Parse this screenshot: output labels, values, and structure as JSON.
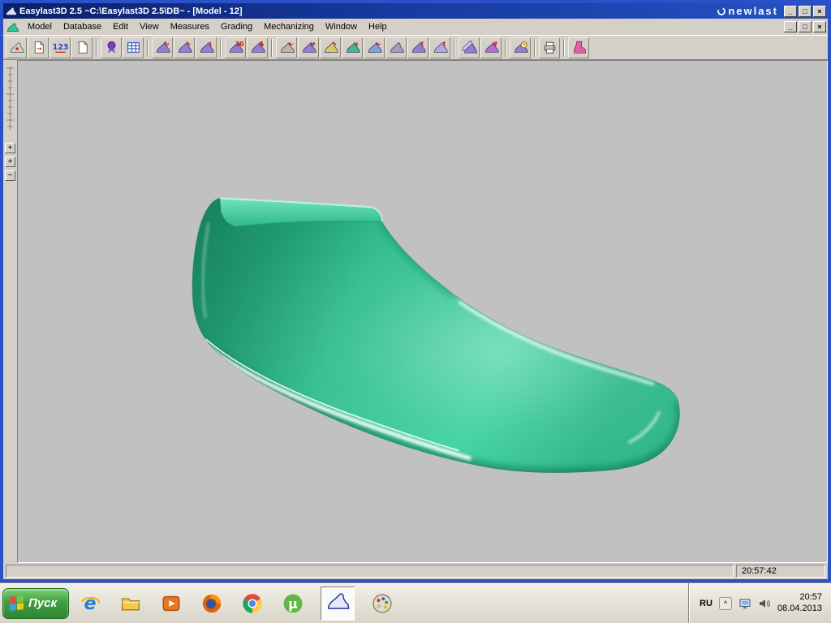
{
  "window": {
    "title": "Easylast3D 2.5 ~C:\\Easylast3D 2.5\\DB~ - [Model - 12]",
    "brand": "newlast",
    "controls": {
      "minimize": "_",
      "maximize": "□",
      "restore": "□",
      "close": "×"
    }
  },
  "menu": {
    "items": [
      "Model",
      "Database",
      "Edit",
      "View",
      "Measures",
      "Grading",
      "Mechanizing",
      "Window",
      "Help"
    ]
  },
  "toolbar": {
    "buttons": [
      {
        "name": "last-top-view",
        "kind": "outline",
        "color": "#6a7a88"
      },
      {
        "name": "import-model",
        "kind": "page",
        "glyph": "→"
      },
      {
        "name": "measurement-digits",
        "kind": "digits",
        "color": "#2a48c0"
      },
      {
        "name": "export-page",
        "kind": "page"
      },
      {
        "name": "wizard",
        "kind": "ribbon",
        "color": "#7b3fc4",
        "sep_before": true
      },
      {
        "name": "size-table",
        "kind": "grid",
        "color": "#2a50c0"
      },
      {
        "name": "last-rotate",
        "kind": "shoe",
        "color": "#8f7fd8",
        "glyph": "↻",
        "sep_before": true
      },
      {
        "name": "last-edit",
        "kind": "shoe",
        "color": "#8f7fd8",
        "glyph": "✎"
      },
      {
        "name": "last-lower",
        "kind": "shoe",
        "color": "#8f7fd8",
        "glyph": "↓"
      },
      {
        "name": "angle-30",
        "kind": "shoe",
        "color": "#8f7fd8",
        "glyph": "30",
        "sep_before": true
      },
      {
        "name": "compass-measure",
        "kind": "shoe",
        "color": "#8f7fd8",
        "glyph": "A"
      },
      {
        "name": "foot-measure",
        "kind": "shoe",
        "color": "#c8b2a0",
        "glyph": "←",
        "sep_before": true
      },
      {
        "name": "last-stretch",
        "kind": "shoe",
        "color": "#8f7fd8",
        "glyph": "⇄"
      },
      {
        "name": "last-mark",
        "kind": "shoe",
        "color": "#d8c860",
        "glyph": "✎"
      },
      {
        "name": "last-remove",
        "kind": "shoe",
        "color": "#40b890",
        "glyph": "×"
      },
      {
        "name": "last-shift",
        "kind": "shoe",
        "color": "#80a0e0",
        "glyph": "←"
      },
      {
        "name": "last-copy",
        "kind": "shoe",
        "color": "#a0a0b0"
      },
      {
        "name": "last-height",
        "kind": "shoe",
        "color": "#8f7fd8",
        "glyph": "↕"
      },
      {
        "name": "last-adjust",
        "kind": "shoe",
        "color": "#b0a8e0",
        "glyph": "↕"
      },
      {
        "name": "compare-lasts",
        "kind": "shoe2",
        "color": "#8f7fd8",
        "sep_before": true
      },
      {
        "name": "last-net",
        "kind": "shoe",
        "color": "#b06fd8",
        "glyph": "#"
      },
      {
        "name": "last-zoom-time",
        "kind": "magnify",
        "color": "#8f7fd8",
        "sep_before": true
      },
      {
        "name": "print",
        "kind": "printer",
        "color": "#808080",
        "sep_before": true
      },
      {
        "name": "last-info",
        "kind": "boot",
        "color": "#e060a8",
        "sep_before": true
      }
    ]
  },
  "side_panel": {
    "buttons": [
      {
        "name": "zoom-in-1",
        "glyph": "+"
      },
      {
        "name": "zoom-in-2",
        "glyph": "+"
      },
      {
        "name": "zoom-out",
        "glyph": "−"
      }
    ]
  },
  "model": {
    "body_color": "#2cbd8d",
    "top_color": "#49d6a8",
    "shadow_color": "#0c6b4c",
    "highlight_color": "#ffffff",
    "canvas_background": "#c1c1c1"
  },
  "statusbar": {
    "time": "20:57:42"
  },
  "taskbar": {
    "start_label": "Пуск",
    "quick_launch": [
      {
        "name": "internet-explorer",
        "kind": "ie"
      },
      {
        "name": "file-explorer",
        "kind": "folder"
      },
      {
        "name": "media-player",
        "kind": "media"
      },
      {
        "name": "firefox",
        "kind": "firefox"
      },
      {
        "name": "chrome",
        "kind": "chrome"
      },
      {
        "name": "utorrent",
        "kind": "utorrent"
      },
      {
        "name": "easylast-app",
        "kind": "shoeapp",
        "active": true
      },
      {
        "name": "paint-palette",
        "kind": "palette"
      }
    ],
    "tray": {
      "language": "RU",
      "chevron": "^",
      "time": "20:57",
      "date": "08.04.2013"
    }
  }
}
